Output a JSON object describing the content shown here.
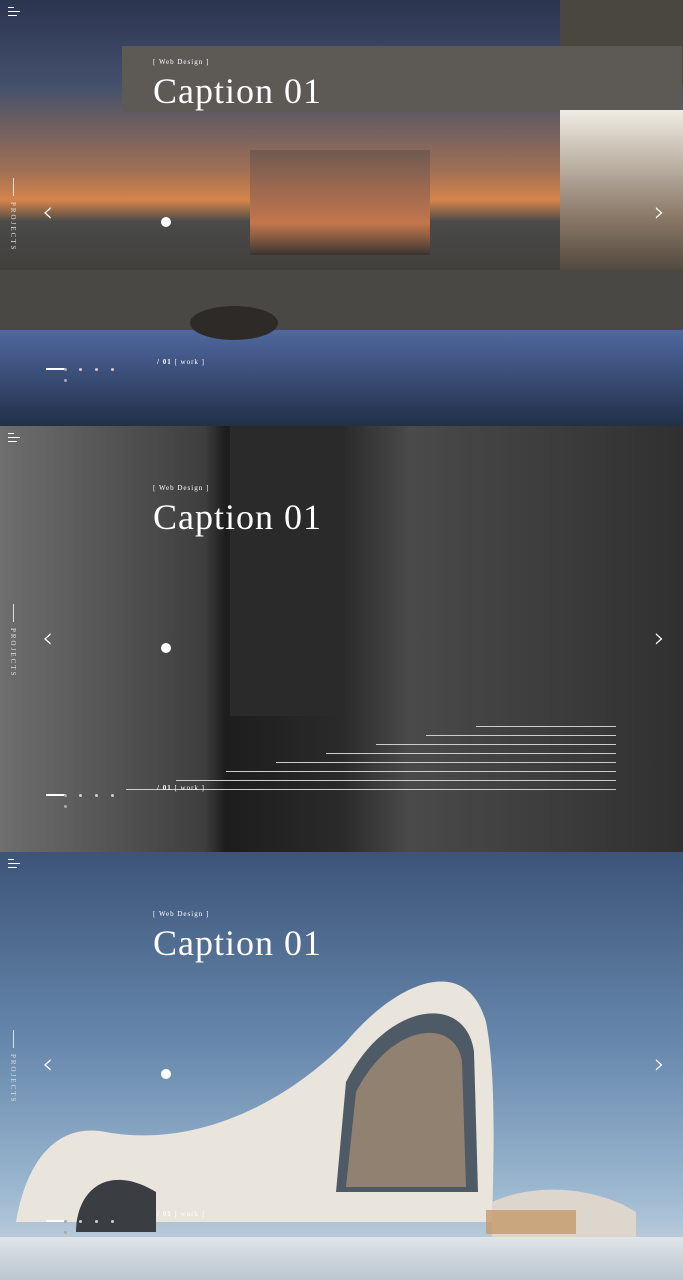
{
  "slides": [
    {
      "tag": "[ Web Design ]",
      "caption": "Caption 01",
      "side_label": "PROJECTS",
      "work_number": "/ 01",
      "work_label": "[ work ]"
    },
    {
      "tag": "[ Web Design ]",
      "caption": "Caption 01",
      "side_label": "PROJECTS",
      "work_number": "/ 01",
      "work_label": "[ work ]"
    },
    {
      "tag": "[ Web Design ]",
      "caption": "Caption 01",
      "side_label": "PROJECTS",
      "work_number": "/ 01",
      "work_label": "[ work ]"
    }
  ],
  "icons": {
    "menu": "hamburger-menu-icon",
    "prev": "chevron-left-icon",
    "next": "chevron-right-icon"
  },
  "arrows": {
    "prev": "‹",
    "next": "›"
  },
  "colors": {
    "text": "#ffffff",
    "accent": "#ffffff"
  }
}
